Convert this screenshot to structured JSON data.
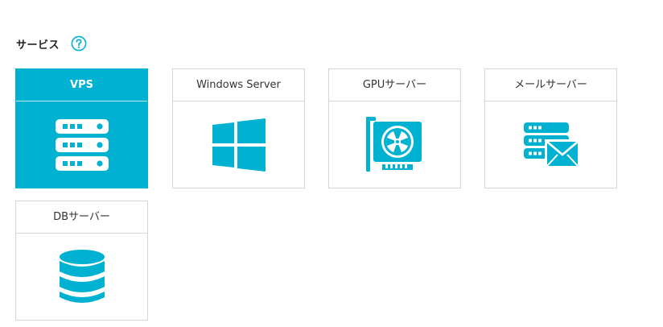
{
  "section": {
    "title": "サービス",
    "help_icon": "question-circle-icon"
  },
  "colors": {
    "accent": "#00b1d2",
    "card_border": "#d6d6d6",
    "selected_text": "#ffffff"
  },
  "services": [
    {
      "label": "VPS",
      "icon": "server-stack-icon",
      "selected": true
    },
    {
      "label": "Windows Server",
      "icon": "windows-logo-icon",
      "selected": false
    },
    {
      "label": "GPUサーバー",
      "icon": "gpu-card-icon",
      "selected": false
    },
    {
      "label": "メールサーバー",
      "icon": "mail-server-icon",
      "selected": false
    },
    {
      "label": "DBサーバー",
      "icon": "database-icon",
      "selected": false
    }
  ]
}
